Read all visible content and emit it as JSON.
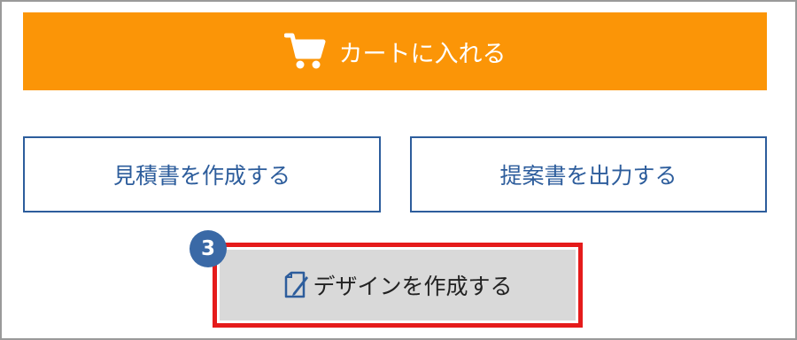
{
  "cart_button": {
    "label": "カートに入れる",
    "icon": "cart-icon",
    "color": "#fb9507"
  },
  "estimate_button": {
    "label": "見積書を作成する"
  },
  "proposal_button": {
    "label": "提案書を出力する"
  },
  "design_button": {
    "label": "デザインを作成する",
    "icon": "edit-document-icon"
  },
  "step_badge": {
    "number": "3",
    "color": "#3a69a6"
  },
  "highlight_color": "#e51b1b",
  "accent_color": "#2d5d9c"
}
